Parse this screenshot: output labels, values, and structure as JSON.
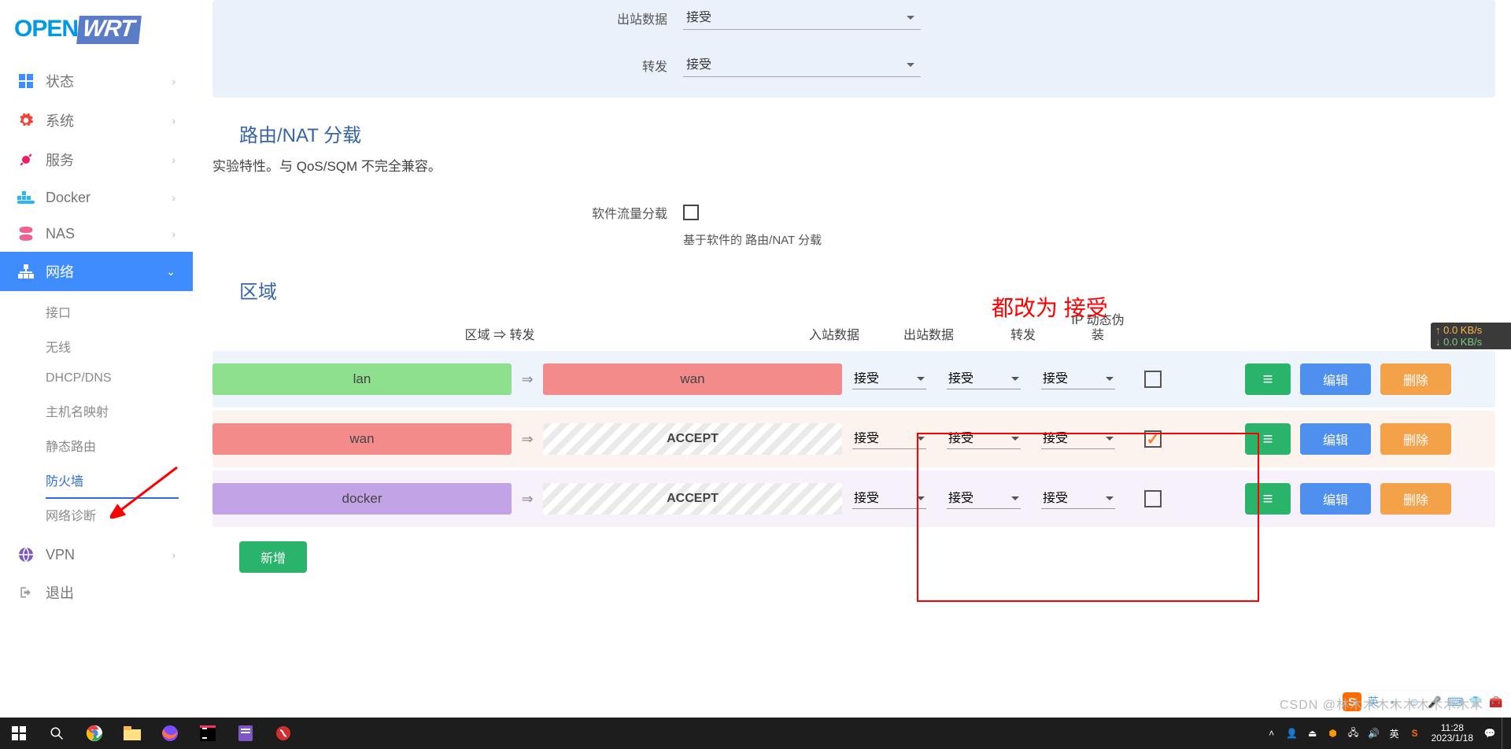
{
  "logo": {
    "open": "OPEN",
    "wrt": "WRT"
  },
  "sidebar": {
    "items": [
      {
        "label": "状态"
      },
      {
        "label": "系统"
      },
      {
        "label": "服务"
      },
      {
        "label": "Docker"
      },
      {
        "label": "NAS"
      },
      {
        "label": "网络"
      },
      {
        "label": "VPN"
      },
      {
        "label": "退出"
      }
    ],
    "submenu": [
      {
        "label": "接口"
      },
      {
        "label": "无线"
      },
      {
        "label": "DHCP/DNS"
      },
      {
        "label": "主机名映射"
      },
      {
        "label": "静态路由"
      },
      {
        "label": "防火墙"
      },
      {
        "label": "网络诊断"
      }
    ]
  },
  "form": {
    "outbound_label": "出站数据",
    "outbound_value": "接受",
    "forward_label": "转发",
    "forward_value": "接受",
    "offload_section": "路由/NAT 分载",
    "offload_desc": "实验特性。与 QoS/SQM 不完全兼容。",
    "soft_offload_label": "软件流量分载",
    "soft_offload_hint": "基于软件的 路由/NAT 分载"
  },
  "zones": {
    "section_title": "区域",
    "annotation": "都改为 接受",
    "headers": {
      "zone": "区域 ⇒ 转发",
      "in": "入站数据",
      "out": "出站数据",
      "fwd": "转发",
      "masq": "IP 动态伪装"
    },
    "accept_text": "ACCEPT",
    "select_value": "接受",
    "rows": [
      {
        "name": "lan",
        "fwd_target": "wan",
        "fwd_kind": "zone-red",
        "masq": false,
        "bg": "b-blue",
        "chip": "chip-green"
      },
      {
        "name": "wan",
        "fwd_target": "ACCEPT",
        "fwd_kind": "accept",
        "masq": true,
        "bg": "b-pink",
        "chip": "chip-red"
      },
      {
        "name": "docker",
        "fwd_target": "ACCEPT",
        "fwd_kind": "accept",
        "masq": false,
        "bg": "b-lilac",
        "chip": "chip-purple"
      }
    ],
    "arrow": "⇒",
    "btn_menu": "≡",
    "btn_edit": "编辑",
    "btn_delete": "删除",
    "btn_add": "新增"
  },
  "netspeed": {
    "up": "↑ 0.0 KB/s",
    "down": "↓ 0.0 KB/s"
  },
  "watermark": "CSDN @林木木木木木木木木木木",
  "taskbar": {
    "clock_time": "11:28",
    "clock_date": "2023/1/18",
    "ime": "英"
  }
}
